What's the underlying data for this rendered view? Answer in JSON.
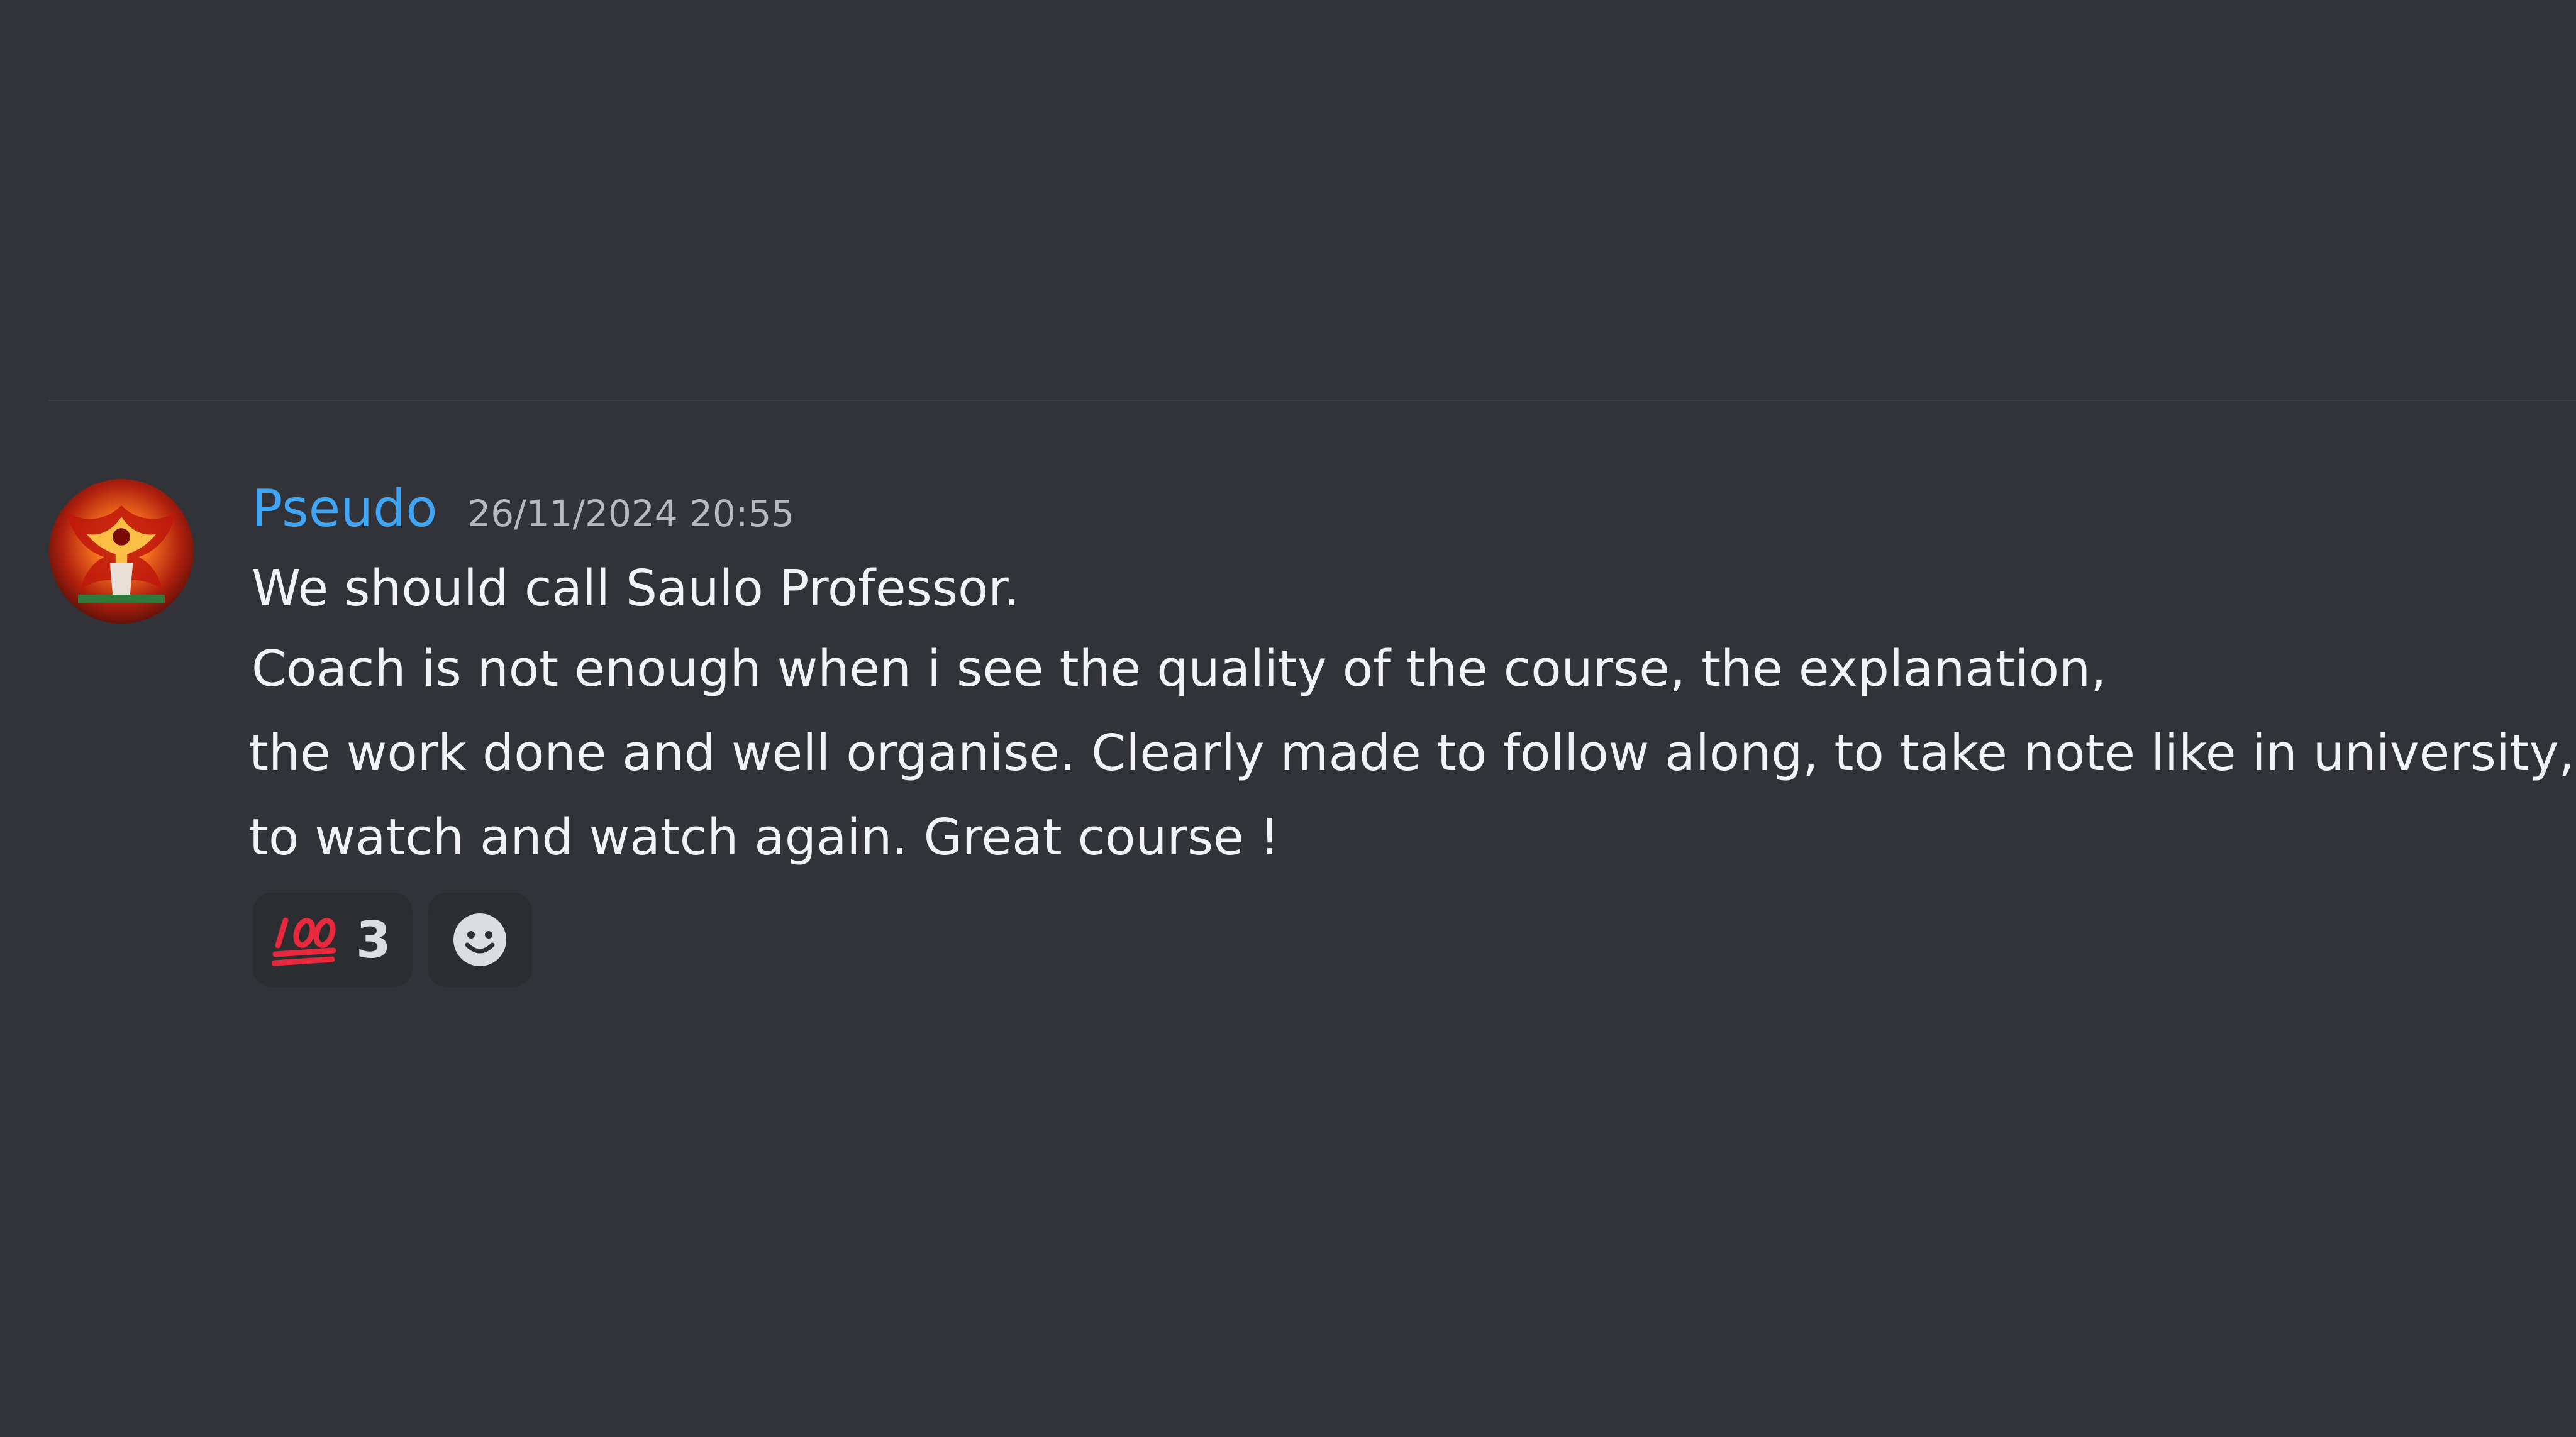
{
  "message": {
    "author": "Pseudo",
    "timestamp": "26/11/2024 20:55",
    "lines": [
      "We should call Saulo Professor.",
      "Coach is not enough when i see the quality of the course, the explanation,",
      "the work done and well organise.  Clearly made to follow along, to take note like in university,",
      "to watch and watch again. Great course !"
    ]
  },
  "reactions": [
    {
      "emoji": "hundred-points-icon",
      "count": "3"
    },
    {
      "emoji": "add-reaction-icon"
    }
  ],
  "colors": {
    "background": "#313338",
    "username": "#3fa5f4",
    "text": "#f2f3f5",
    "timestamp": "#b5bac1",
    "reaction_bg": "#2b2d31"
  }
}
